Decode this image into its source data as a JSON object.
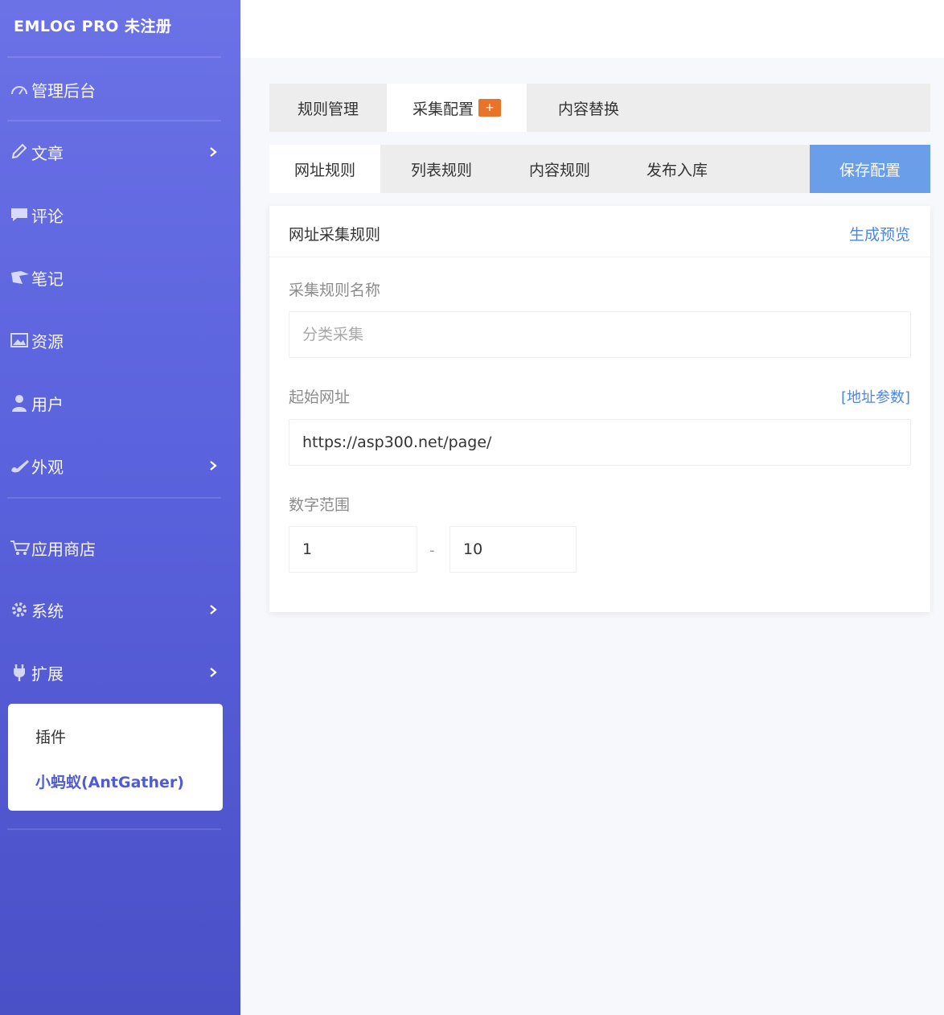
{
  "sidebar": {
    "brand": "EMLOG PRO 未注册",
    "items": [
      {
        "label": "管理后台",
        "icon": "dashboard-icon"
      },
      {
        "label": "文章",
        "icon": "pencil-icon"
      },
      {
        "label": "评论",
        "icon": "comment-icon"
      },
      {
        "label": "笔记",
        "icon": "note-icon"
      },
      {
        "label": "资源",
        "icon": "image-icon"
      },
      {
        "label": "用户",
        "icon": "user-icon"
      },
      {
        "label": "外观",
        "icon": "brush-icon"
      },
      {
        "label": "应用商店",
        "icon": "cart-icon"
      },
      {
        "label": "系统",
        "icon": "gear-icon"
      },
      {
        "label": "扩展",
        "icon": "plug-icon"
      }
    ],
    "submenu": {
      "title": "插件",
      "link": "小蚂蚁(AntGather)"
    }
  },
  "tabs_top": {
    "items": [
      "规则管理",
      "采集配置",
      "内容替换"
    ],
    "badge": "+"
  },
  "tabs_sub": {
    "items": [
      "网址规则",
      "列表规则",
      "内容规则",
      "发布入库"
    ],
    "save_label": "保存配置"
  },
  "card": {
    "title": "网址采集规则",
    "preview_link": "生成预览",
    "rule_name_label": "采集规则名称",
    "rule_name_placeholder": "分类采集",
    "start_url_label": "起始网址",
    "param_link": "[地址参数]",
    "start_url_value": "https://asp300.net/page/",
    "range_label": "数字范围",
    "range_from": "1",
    "range_sep": "-",
    "range_to": "10"
  },
  "colors": {
    "sidebar_top": "#6b72e6",
    "sidebar_bottom": "#4a50c6",
    "save_button": "#6a9ee9",
    "link": "#4e86e4",
    "badge": "#e8742a"
  }
}
